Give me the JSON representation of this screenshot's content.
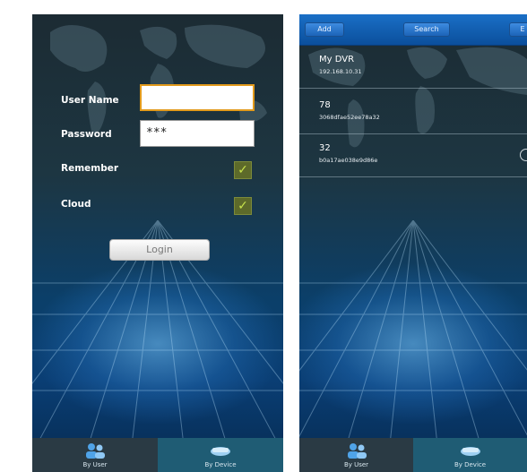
{
  "login_screen": {
    "username_label": "User Name",
    "username_value": "",
    "password_label": "Password",
    "password_value": "***",
    "remember_label": "Remember",
    "remember_checked": true,
    "cloud_label": "Cloud",
    "cloud_checked": true,
    "check_glyph": "✓",
    "login_button": "Login",
    "tabs": [
      {
        "label": "By User",
        "icon": "users-icon",
        "active": true
      },
      {
        "label": "By Device",
        "icon": "device-icon",
        "active": false
      }
    ]
  },
  "device_screen": {
    "toolbar": {
      "add_label": "Add",
      "search_label": "Search",
      "edit_label": "E"
    },
    "devices": [
      {
        "name": "My DVR",
        "detail": "192.168.10.31"
      },
      {
        "name": "78",
        "detail": "3068dfae52ee78a32"
      },
      {
        "name": "32",
        "detail": "b0a17ae038e9d86e"
      }
    ],
    "tabs": [
      {
        "label": "By User",
        "icon": "users-icon",
        "active": true
      },
      {
        "label": "By Device",
        "icon": "device-icon",
        "active": false
      }
    ]
  },
  "colors": {
    "accent_focus": "#e29a1c",
    "check_green": "#c7e34c",
    "toolbar_blue": "#1a6fc6"
  }
}
